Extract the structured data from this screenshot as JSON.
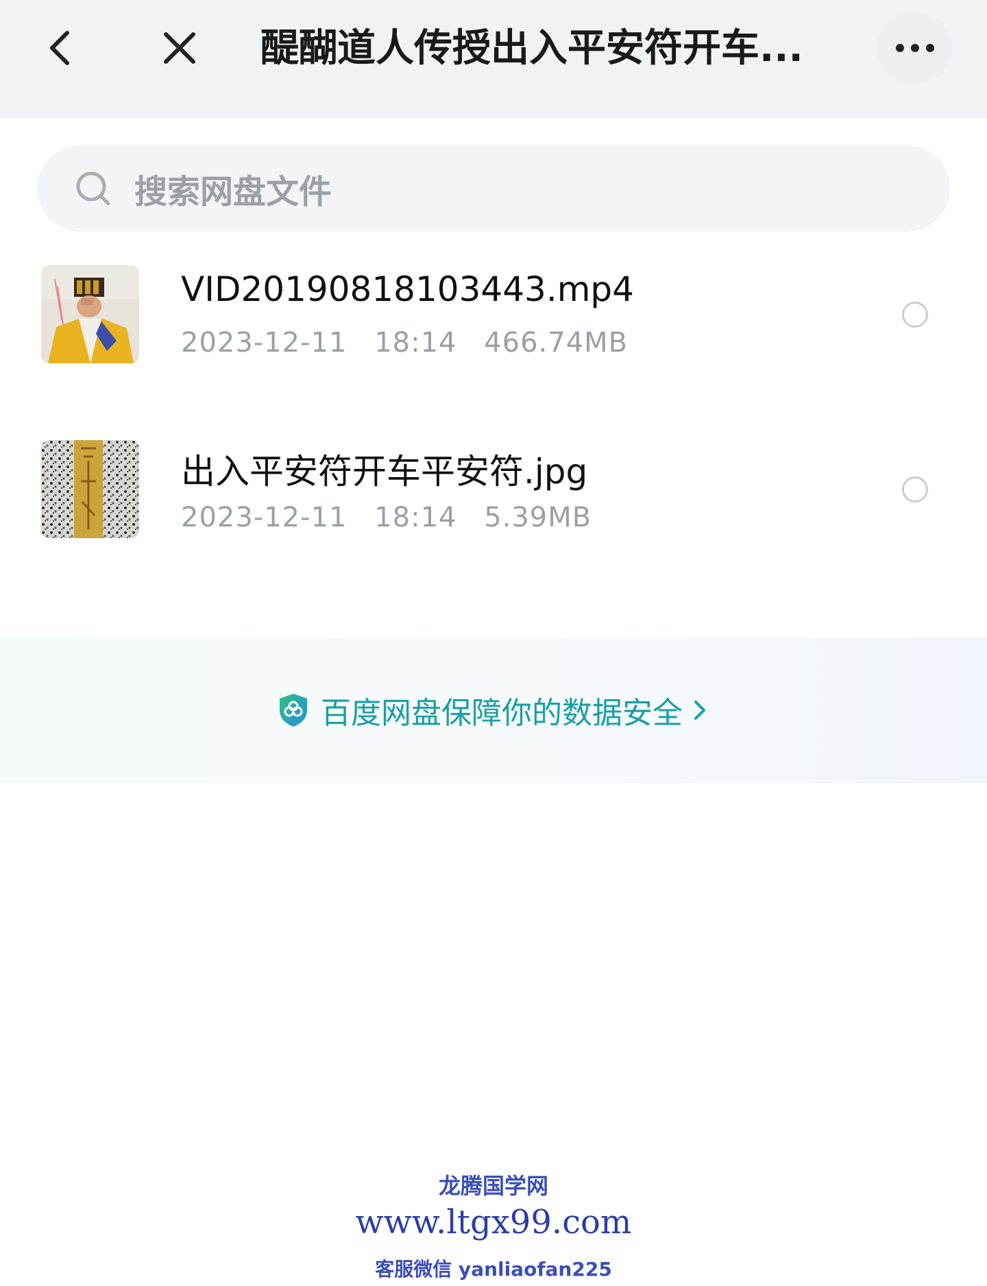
{
  "header": {
    "title": "醍醐道人传授出入平安符开车...",
    "back_icon": "chevron-left-icon",
    "close_icon": "close-icon",
    "more_icon": "more-horizontal-icon"
  },
  "search": {
    "placeholder": "搜索网盘文件",
    "icon": "search-icon"
  },
  "files": [
    {
      "name": "VID20190818103443.mp4",
      "date": "2023-12-11",
      "time": "18:14",
      "size": "466.74MB",
      "selected": false
    },
    {
      "name": "出入平安符开车平安符.jpg",
      "date": "2023-12-11",
      "time": "18:14",
      "size": "5.39MB",
      "selected": false
    }
  ],
  "security_banner": {
    "text": "百度网盘保障你的数据安全",
    "icon": "shield-icon",
    "accent": "#1a9fa3"
  },
  "watermark": {
    "line1": "龙腾国学网",
    "line2": "www.ltgx99.com",
    "line3": "客服微信 yanliaofan225"
  }
}
